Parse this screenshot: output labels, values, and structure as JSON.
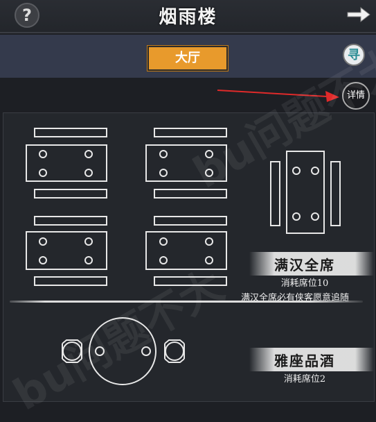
{
  "header": {
    "title": "烟雨楼",
    "help_icon": "question-mark-icon",
    "back_icon": "arrow-right-icon"
  },
  "tabs": [
    {
      "label": "大厅",
      "active": true
    }
  ],
  "side_buttons": {
    "seal_label": "寻",
    "detail_label": "详情"
  },
  "areas": [
    {
      "title": "满汉全席",
      "cost": "消耗席位10",
      "desc": "满汉全席必有侠客愿意追随"
    },
    {
      "title": "雅座品酒",
      "cost": "消耗席位2"
    }
  ],
  "watermark": "bu问题不大",
  "colors": {
    "accent": "#e89a2c",
    "arrow": "#e02a2a",
    "furniture": "#e8e8e8"
  }
}
